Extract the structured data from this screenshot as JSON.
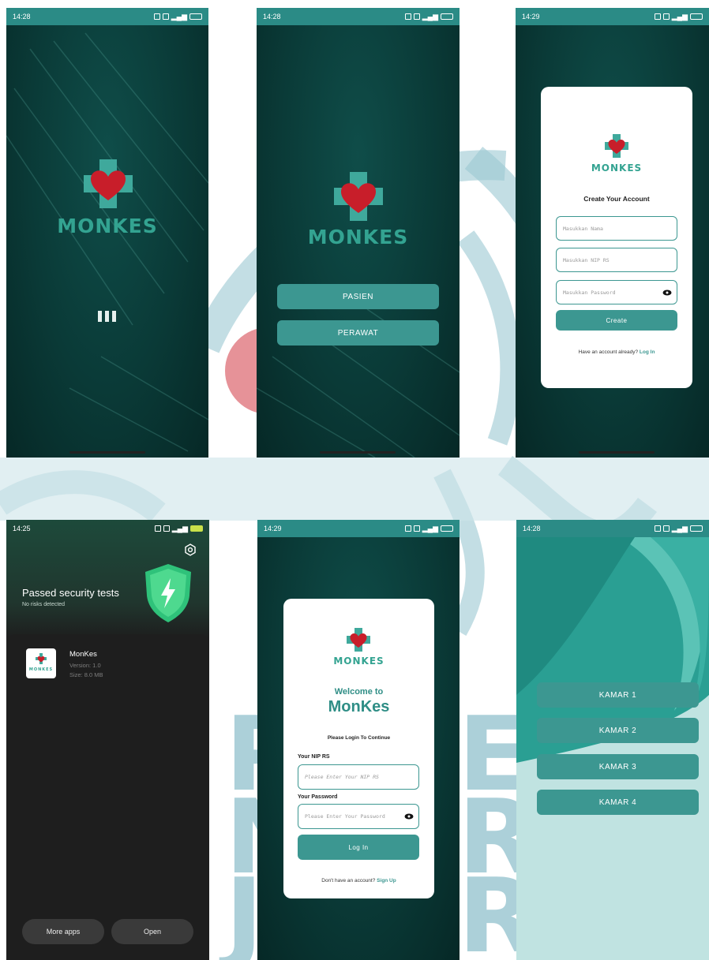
{
  "brand": {
    "name": "MONKES",
    "accent": "#3c9791",
    "logo_green": "#33a391",
    "heart_red": "#c81e2a"
  },
  "screen1": {
    "time": "14:28",
    "loader_icon": "bars-loading-icon"
  },
  "screen2": {
    "time": "14:28",
    "buttons": [
      "PASIEN",
      "PERAWAT"
    ]
  },
  "screen3": {
    "time": "14:29",
    "title": "Create Your Account",
    "name_placeholder": "Masukkan Nama",
    "nip_placeholder": "Masukkan NIP RS",
    "password_placeholder": "Masukkan Password",
    "create_button": "Create",
    "footer_text": "Have an account already?",
    "login_link": "Log In"
  },
  "screen4": {
    "time": "14:25",
    "heading": "Passed security tests",
    "subheading": "No risks detected",
    "app_name": "MonKes",
    "version": "Version: 1.0",
    "size": "Size: 8.0 MB",
    "app_logo_text": "MONKES",
    "more_apps": "More apps",
    "open": "Open"
  },
  "screen5": {
    "time": "14:29",
    "welcome": "Welcome to",
    "app_title": "MonKes",
    "subtitle": "Please Login To Continue",
    "nip_label": "Your NIP RS",
    "nip_placeholder": "Please Enter Your NIP RS",
    "password_label": "Your Password",
    "password_placeholder": "Please Enter Your Password",
    "login_button": "Log In",
    "footer_text": "Don't have an account?",
    "signup_link": "Sign Up"
  },
  "screen6": {
    "time": "14:28",
    "rooms": [
      "KAMAR 1",
      "KAMAR 2",
      "KAMAR 3",
      "KAMAR 4"
    ]
  },
  "watermark": {
    "line1": "P",
    "line1b": "EK",
    "line2": "N",
    "line2b": "RI",
    "line3": "J",
    "line3b": "RTA"
  }
}
